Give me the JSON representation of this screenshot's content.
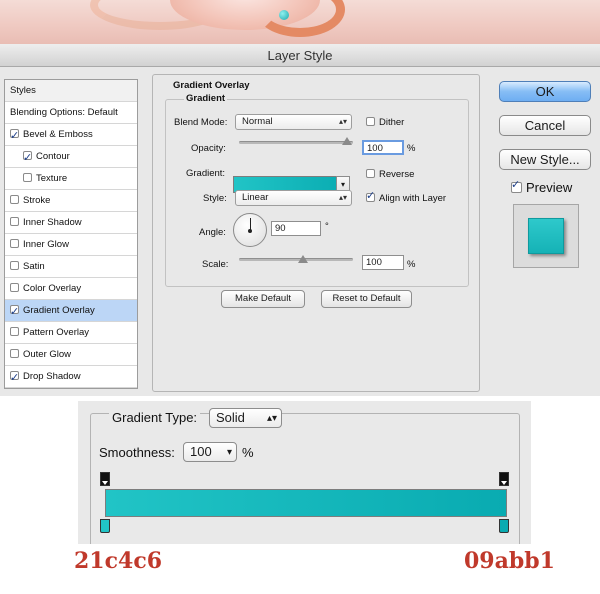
{
  "dialog": {
    "title": "Layer Style"
  },
  "styles_list": {
    "header": "Styles",
    "items": [
      {
        "label": "Blending Options: Default",
        "checkbox": false,
        "checked": false,
        "indent": false,
        "selected": false
      },
      {
        "label": "Bevel & Emboss",
        "checkbox": true,
        "checked": true,
        "indent": false,
        "selected": false
      },
      {
        "label": "Contour",
        "checkbox": true,
        "checked": true,
        "indent": true,
        "selected": false
      },
      {
        "label": "Texture",
        "checkbox": true,
        "checked": false,
        "indent": true,
        "selected": false
      },
      {
        "label": "Stroke",
        "checkbox": true,
        "checked": false,
        "indent": false,
        "selected": false
      },
      {
        "label": "Inner Shadow",
        "checkbox": true,
        "checked": false,
        "indent": false,
        "selected": false
      },
      {
        "label": "Inner Glow",
        "checkbox": true,
        "checked": false,
        "indent": false,
        "selected": false
      },
      {
        "label": "Satin",
        "checkbox": true,
        "checked": false,
        "indent": false,
        "selected": false
      },
      {
        "label": "Color Overlay",
        "checkbox": true,
        "checked": false,
        "indent": false,
        "selected": false
      },
      {
        "label": "Gradient Overlay",
        "checkbox": true,
        "checked": true,
        "indent": false,
        "selected": true
      },
      {
        "label": "Pattern Overlay",
        "checkbox": true,
        "checked": false,
        "indent": false,
        "selected": false
      },
      {
        "label": "Outer Glow",
        "checkbox": true,
        "checked": false,
        "indent": false,
        "selected": false
      },
      {
        "label": "Drop Shadow",
        "checkbox": true,
        "checked": true,
        "indent": false,
        "selected": false
      }
    ]
  },
  "gradient_overlay": {
    "section_title": "Gradient Overlay",
    "group_title": "Gradient",
    "blend_mode_label": "Blend Mode:",
    "blend_mode_value": "Normal",
    "dither_label": "Dither",
    "dither_checked": false,
    "opacity_label": "Opacity:",
    "opacity_value": "100",
    "opacity_unit": "%",
    "gradient_label": "Gradient:",
    "reverse_label": "Reverse",
    "reverse_checked": false,
    "style_label": "Style:",
    "style_value": "Linear",
    "align_label": "Align with Layer",
    "align_checked": true,
    "angle_label": "Angle:",
    "angle_value": "90",
    "angle_unit": "°",
    "scale_label": "Scale:",
    "scale_value": "100",
    "scale_unit": "%",
    "make_default_label": "Make Default",
    "reset_default_label": "Reset to Default"
  },
  "side_buttons": {
    "ok": "OK",
    "cancel": "Cancel",
    "new_style": "New Style...",
    "preview_label": "Preview",
    "preview_checked": true
  },
  "gradient_editor": {
    "type_label": "Gradient Type:",
    "type_value": "Solid",
    "smoothness_label": "Smoothness:",
    "smoothness_value": "100",
    "smoothness_unit": "%"
  },
  "colors": {
    "start_hex": "21c4c6",
    "end_hex": "09abb1",
    "start": "#21c4c6",
    "end": "#09abb1"
  }
}
